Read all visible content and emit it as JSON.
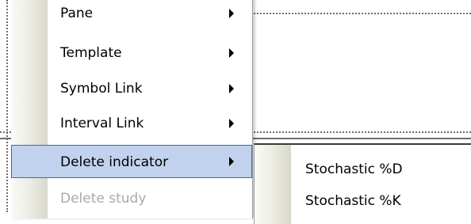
{
  "context_menu": {
    "items": [
      {
        "label": "Pane",
        "has_submenu": true,
        "enabled": true
      },
      {
        "label": "Template",
        "has_submenu": true,
        "enabled": true
      },
      {
        "label": "Symbol Link",
        "has_submenu": true,
        "enabled": true
      },
      {
        "label": "Interval Link",
        "has_submenu": true,
        "enabled": true
      },
      {
        "label": "Delete indicator",
        "has_submenu": true,
        "enabled": true,
        "highlighted": true
      },
      {
        "label": "Delete study",
        "has_submenu": false,
        "enabled": false
      }
    ]
  },
  "submenu": {
    "items": [
      {
        "label": "Stochastic %D"
      },
      {
        "label": "Stochastic %K"
      }
    ]
  },
  "colors": {
    "highlight_fill": "#c1d2ee",
    "highlight_border": "#316ac5",
    "disabled_text": "#a9a9a9"
  }
}
